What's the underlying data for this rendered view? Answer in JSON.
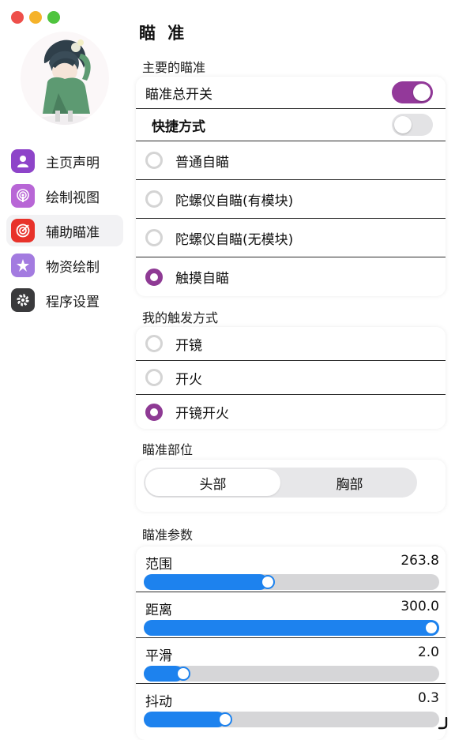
{
  "window": {
    "title": "瞄 准"
  },
  "sidebar": {
    "items": [
      {
        "label": "主页声明",
        "icon": "user-icon",
        "color": "#8e44c9"
      },
      {
        "label": "绘制视图",
        "icon": "podcast-icon",
        "color": "#b866d6"
      },
      {
        "label": "辅助瞄准",
        "icon": "target-icon",
        "color": "#e8322a",
        "active": true
      },
      {
        "label": "物资绘制",
        "icon": "star-icon",
        "color": "#a37be0"
      },
      {
        "label": "程序设置",
        "icon": "gear-icon",
        "color": "#3a3a3c"
      }
    ]
  },
  "main_aim": {
    "section_label": "主要的瞄准",
    "master_switch": {
      "label": "瞄准总开关",
      "on": true
    },
    "shortcut": {
      "label": "快捷方式",
      "on": false
    },
    "modes": [
      {
        "label": "普通自瞄",
        "checked": false
      },
      {
        "label": "陀螺仪自瞄(有模块)",
        "checked": false
      },
      {
        "label": "陀螺仪自瞄(无模块)",
        "checked": false
      },
      {
        "label": "触摸自瞄",
        "checked": true
      }
    ]
  },
  "trigger": {
    "section_label": "我的触发方式",
    "options": [
      {
        "label": "开镜",
        "checked": false
      },
      {
        "label": "开火",
        "checked": false
      },
      {
        "label": "开镜开火",
        "checked": true
      }
    ]
  },
  "aim_part": {
    "section_label": "瞄准部位",
    "options": [
      "头部",
      "胸部"
    ],
    "selected": 0
  },
  "params": {
    "section_label": "瞄准参数",
    "sliders": [
      {
        "label": "范围",
        "value": "263.8",
        "fraction": 0.42
      },
      {
        "label": "距离",
        "value": "300.0",
        "fraction": 1.0
      },
      {
        "label": "平滑",
        "value": "2.0",
        "fraction": 0.135
      },
      {
        "label": "抖动",
        "value": "0.3",
        "fraction": 0.275
      }
    ]
  },
  "colors": {
    "accent": "#93399a",
    "slider": "#1d82ee"
  }
}
